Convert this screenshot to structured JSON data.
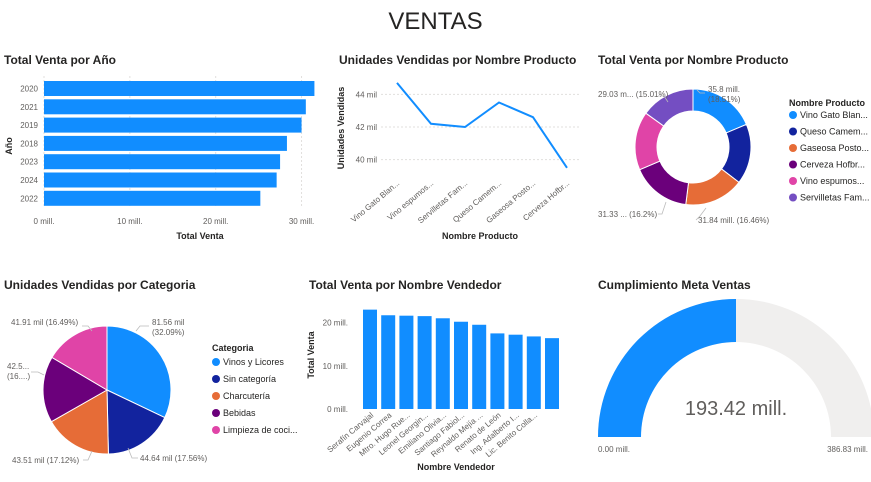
{
  "page_title": "VENTAS",
  "chart_data": [
    {
      "type": "bar",
      "orientation": "horizontal",
      "title": "Total Venta por Año",
      "xlabel": "Total Venta",
      "ylabel": "Año",
      "categories": [
        "2020",
        "2021",
        "2019",
        "2018",
        "2023",
        "2024",
        "2022"
      ],
      "values": [
        31.5,
        30.5,
        30.0,
        28.3,
        27.5,
        27.1,
        25.2
      ],
      "xlim": [
        0,
        32.5
      ],
      "x_ticks": [
        "0 mill.",
        "10 mill.",
        "20 mill.",
        "30 mill."
      ],
      "grid": true,
      "color": "#118DFF"
    },
    {
      "type": "line",
      "title": "Unidades Vendidas por Nombre Producto",
      "xlabel": "Nombre Producto",
      "ylabel": "Unidades Vendidas",
      "categories": [
        "Vino Gato Blan...",
        "Vino espumos...",
        "Servilletas Fam...",
        "Queso Camem...",
        "Gaseosa Posto...",
        "Cerveza Hofbr..."
      ],
      "values": [
        44.7,
        42.2,
        42.0,
        43.5,
        42.6,
        39.5
      ],
      "ylim": [
        39,
        45
      ],
      "y_ticks": [
        "44 mil",
        "42 mil",
        "40 mil"
      ],
      "grid": true,
      "color": "#118DFF"
    },
    {
      "type": "pie",
      "donut": true,
      "title": "Total Venta por Nombre Producto",
      "legend_title": "Nombre Producto",
      "legend_position": "right",
      "slices": [
        {
          "name": "Vino Gato Blan...",
          "value": 18.51,
          "label": "35.8 mill.\n(18.51%)",
          "color": "#118DFF"
        },
        {
          "name": "Queso Camem...",
          "value": 16.7,
          "label": "",
          "color": "#12239E"
        },
        {
          "name": "Gaseosa Posto...",
          "value": 16.46,
          "label": "31.84 mill. (16.46%)",
          "color": "#E66C37"
        },
        {
          "name": "Cerveza Hofbr...",
          "value": 16.5,
          "label": "",
          "color": "#6B007B"
        },
        {
          "name": "Vino espumos...",
          "value": 16.2,
          "label": "31.33 ... (16.2%)",
          "color": "#E044A7"
        },
        {
          "name": "Servilletas Fam...",
          "value": 15.01,
          "label": "29.03 m... (15.01%)",
          "color": "#744EC2"
        }
      ]
    },
    {
      "type": "pie",
      "title": "Unidades Vendidas por Categoria",
      "legend_title": "Categoria",
      "legend_position": "right",
      "slices": [
        {
          "name": "Vinos y Licores",
          "value": 32.09,
          "label": "81.56 mil\n(32.09%)",
          "color": "#118DFF"
        },
        {
          "name": "Sin categoría",
          "value": 17.56,
          "label": "44.64 mil (17.56%)",
          "color": "#12239E"
        },
        {
          "name": "Charcutería",
          "value": 17.12,
          "label": "43.51 mil (17.12%)",
          "color": "#E66C37"
        },
        {
          "name": "Bebidas",
          "value": 16.74,
          "label": "42.5...\n(16....)",
          "color": "#6B007B"
        },
        {
          "name": "Limpieza de coci...",
          "value": 16.49,
          "label": "41.91 mil (16.49%)",
          "color": "#E044A7"
        }
      ]
    },
    {
      "type": "bar",
      "title": "Total Venta por Nombre Vendedor",
      "xlabel": "Nombre Vendedor",
      "ylabel": "Total Venta",
      "categories": [
        "Serafín Carvajal",
        "Eugenio Correa",
        "Mtro. Hugo Rue...",
        "Leonel Georgin...",
        "Emiliano Olivia...",
        "Santiago Fabiol...",
        "Reynaldo Mejía ...",
        "Renato de León",
        "Ing. Adalberto I...",
        "Lic. Benito Colla...",
        ""
      ],
      "values": [
        23.0,
        21.7,
        21.6,
        21.5,
        21.0,
        20.2,
        19.5,
        17.5,
        17.2,
        16.8,
        16.4
      ],
      "ylim": [
        0,
        25
      ],
      "y_ticks": [
        "20 mill.",
        "10 mill.",
        "0 mill."
      ],
      "color": "#118DFF"
    },
    {
      "type": "gauge",
      "title": "Cumplimiento Meta Ventas",
      "value": 193.42,
      "min": 0,
      "max": 386.83,
      "value_label": "193.42 mill.",
      "min_label": "0.00 mill.",
      "max_label": "386.83 mill.",
      "fill_color": "#118DFF",
      "track_color": "#F0EFEE"
    }
  ]
}
